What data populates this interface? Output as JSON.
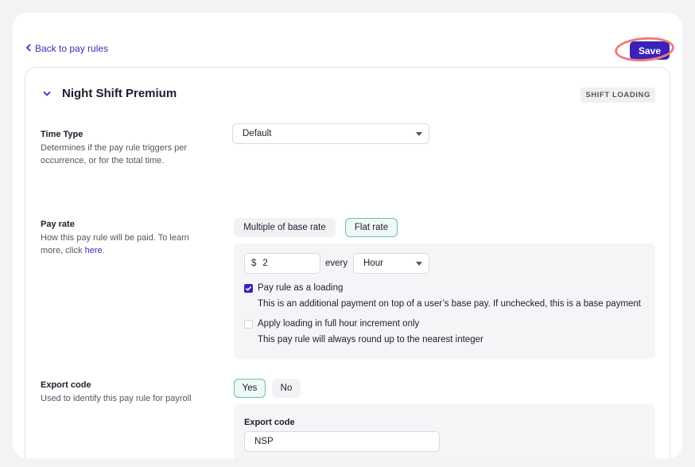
{
  "nav": {
    "back_label": "Back to pay rules",
    "save_label": "Save"
  },
  "rule": {
    "title": "Night Shift Premium",
    "tag": "SHIFT LOADING"
  },
  "time_type": {
    "title": "Time Type",
    "description": "Determines if the pay rule triggers per occurrence, or for the total time.",
    "selected": "Default"
  },
  "pay_rate": {
    "title": "Pay rate",
    "description_prefix": "How this pay rule will be paid. To learn more, click ",
    "link": "here",
    "description_suffix": ".",
    "options": [
      "Multiple of base rate",
      "Flat rate"
    ],
    "active_option": "Flat rate",
    "currency_symbol": "$",
    "amount": "2",
    "every_label": "every",
    "period": "Hour",
    "loading_checkbox": {
      "label": "Pay rule as a loading",
      "checked": true,
      "help": "This is an additional payment on top of a user’s base pay. If unchecked, this is a base payment"
    },
    "increment_checkbox": {
      "label": "Apply loading in full hour increment only",
      "checked": false,
      "help": "This pay rule will always round up to the nearest integer"
    }
  },
  "export": {
    "title": "Export code",
    "description": "Used to identify this pay rule for payroll",
    "options": [
      "Yes",
      "No"
    ],
    "active_option": "Yes",
    "field_label": "Export code",
    "value": "NSP"
  },
  "colors": {
    "accent": "#3a22b8",
    "link": "#3a2fb5",
    "active_segment_border": "#6fbcb2",
    "save_highlight": "#ef7a7a"
  }
}
